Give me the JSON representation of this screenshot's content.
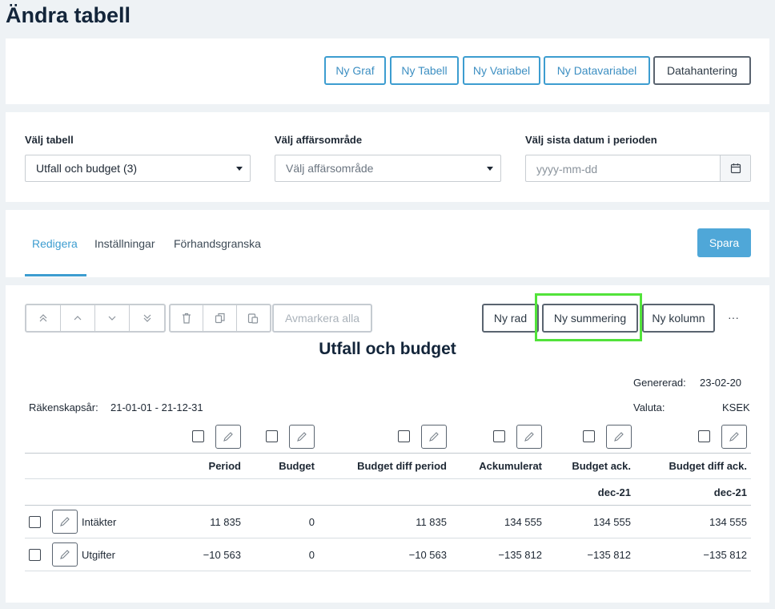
{
  "page": {
    "title": "Ändra tabell"
  },
  "toolbar": {
    "ny_graf": "Ny Graf",
    "ny_tabell": "Ny Tabell",
    "ny_variabel": "Ny Variabel",
    "ny_datavariabel": "Ny Datavariabel",
    "datahantering": "Datahantering"
  },
  "filters": {
    "table_label": "Välj tabell",
    "table_value": "Utfall och budget (3)",
    "area_label": "Välj affärsområde",
    "area_value": "Välj affärsområde",
    "date_label": "Välj sista datum i perioden",
    "date_placeholder": "yyyy-mm-dd"
  },
  "tabs": {
    "edit": "Redigera",
    "settings": "Inställningar",
    "preview": "Förhandsgranska",
    "save": "Spara"
  },
  "editor": {
    "deselect_all": "Avmarkera alla",
    "new_row": "Ny rad",
    "new_sum": "Ny summering",
    "new_column": "Ny kolumn",
    "more": "···"
  },
  "report": {
    "title": "Utfall och budget",
    "generated_label": "Genererad:",
    "generated_value": "23-02-20",
    "fiscal_label": "Räkenskapsår:",
    "fiscal_value": "21-01-01 - 21-12-31",
    "currency_label": "Valuta:",
    "currency_value": "KSEK",
    "columns": [
      {
        "header": "Period",
        "sub": ""
      },
      {
        "header": "Budget",
        "sub": ""
      },
      {
        "header": "Budget diff period",
        "sub": ""
      },
      {
        "header": "Ackumulerat",
        "sub": ""
      },
      {
        "header": "Budget ack.",
        "sub": "dec-21"
      },
      {
        "header": "Budget diff ack.",
        "sub": "dec-21"
      }
    ],
    "rows": [
      {
        "label": "Intäkter",
        "values": [
          "11 835",
          "0",
          "11 835",
          "134 555",
          "134 555",
          "134 555"
        ]
      },
      {
        "label": "Utgifter",
        "values": [
          "−10 563",
          "0",
          "−10 563",
          "−135 812",
          "−135 812",
          "−135 812"
        ]
      }
    ]
  }
}
